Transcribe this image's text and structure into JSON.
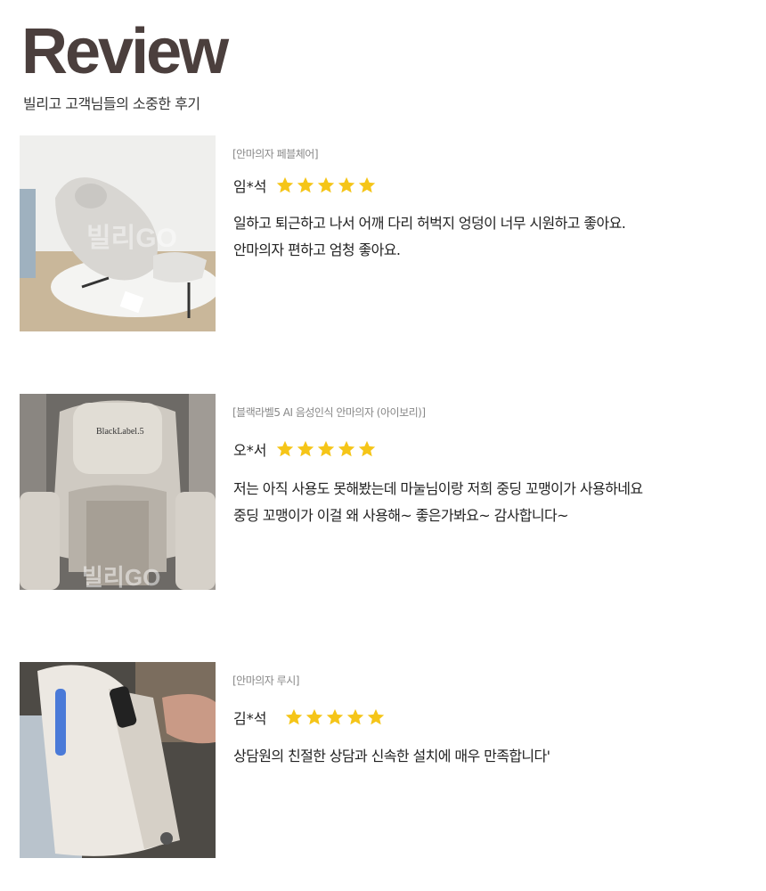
{
  "header": {
    "title": "Review",
    "subtitle": "빌리고 고객님들의 소중한 후기"
  },
  "star_color": "#f5c518",
  "reviews": [
    {
      "product": "[안마의자 페블체어]",
      "reviewer": "임*석",
      "rating": 5,
      "lines": [
        "일하고 퇴근하고 나서 어깨 다리 허벅지 엉덩이 너무 시원하고 좋아요.",
        "안마의자 편하고 엄청 좋아요."
      ],
      "photo": {
        "watermark": "빌리GO"
      }
    },
    {
      "product": "[블랙라벨5 AI 음성인식 안마의자 (아이보리)]",
      "reviewer": "오*서",
      "rating": 5,
      "lines": [
        "저는 아직 사용도 못해봤는데 마눌님이랑 저희 중딩 꼬맹이가 사용하네요",
        "중딩 꼬맹이가 이걸 왜 사용해~ 좋은가봐요~ 감사합니다~"
      ],
      "photo": {
        "watermark": "빌리GO",
        "label": "BlackLabel.5"
      }
    },
    {
      "product": "[안마의자 루시]",
      "reviewer": "김*석",
      "rating": 5,
      "lines": [
        "상담원의 친절한 상담과 신속한 설치에 매우 만족합니다'"
      ],
      "photo": {}
    }
  ]
}
